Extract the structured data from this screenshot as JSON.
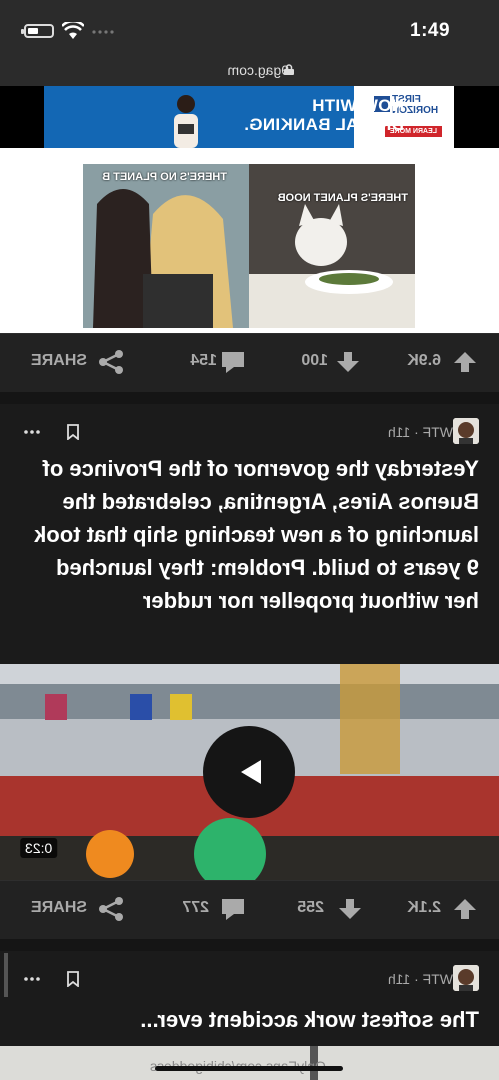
{
  "status_bar": {
    "time": "1:49"
  },
  "browser": {
    "url": "9gag.com"
  },
  "ad": {
    "brand_line1": "FIRST",
    "brand_line2": "HORIZON",
    "cta": "LEARN MORE",
    "headline_line1": "NOW WITH",
    "headline_line2": "DIGITAL BANKING."
  },
  "post1": {
    "meme_caption_left": "THERE'S PLANET NOOB",
    "meme_caption_right": "THERE'S NO PLANET B",
    "upvotes": "6.9K",
    "downvotes": "100",
    "comments": "154",
    "share_label": "SHARE"
  },
  "post2": {
    "section": "WTF",
    "age": "11h",
    "meta": "WTF · 11h",
    "title": "Yesterday the governor of the Province of Buenos Aires, Argentina, celebrated the launching of a new teaching ship that took 9 years to build. Problem: they launched her without propeller nor rudder",
    "duration": "0:23",
    "upvotes": "2.1K",
    "downvotes": "255",
    "comments": "277",
    "share_label": "SHARE"
  },
  "post3": {
    "meta": "WTF · 11h",
    "title": "The softest work accident ever...",
    "watermark": "OnlyFans.com/chibigoddess"
  },
  "icons": {
    "upvote": "arrow-up-icon",
    "downvote": "arrow-down-icon",
    "comment": "speech-bubble-icon",
    "share": "share-icon",
    "more": "more-dots-icon",
    "save": "bookmark-icon"
  },
  "colors": {
    "background": "#1b1b1b",
    "bar": "#222222",
    "text": "#ffffff",
    "muted": "#aaaaaa",
    "ad_blue": "#1367b4"
  }
}
